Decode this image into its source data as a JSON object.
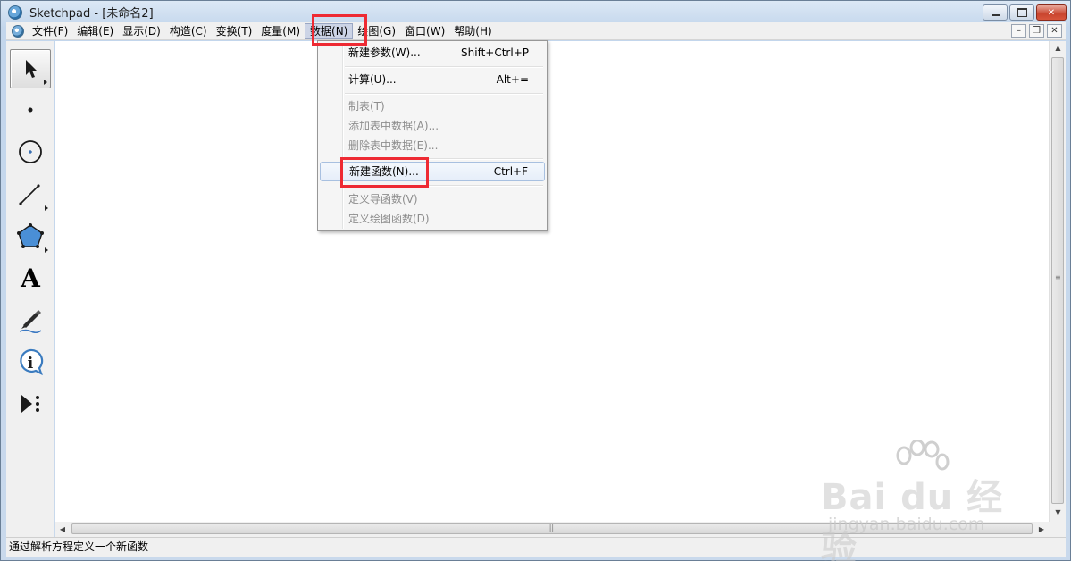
{
  "window": {
    "app_name": "Sketchpad",
    "document_title": " - [未命名2]"
  },
  "menubar": {
    "items": [
      {
        "label": "文件(F)"
      },
      {
        "label": "编辑(E)"
      },
      {
        "label": "显示(D)"
      },
      {
        "label": "构造(C)"
      },
      {
        "label": "变换(T)"
      },
      {
        "label": "度量(M)"
      },
      {
        "label": "数据(N)",
        "active": true
      },
      {
        "label": "绘图(G)"
      },
      {
        "label": "窗口(W)"
      },
      {
        "label": "帮助(H)"
      }
    ]
  },
  "toolbox": {
    "tools": [
      {
        "name": "arrow-select-tool",
        "selected": true
      },
      {
        "name": "point-tool"
      },
      {
        "name": "compass-tool"
      },
      {
        "name": "straightedge-tool"
      },
      {
        "name": "polygon-tool"
      },
      {
        "name": "text-tool",
        "glyph": "A"
      },
      {
        "name": "marker-tool"
      },
      {
        "name": "information-tool",
        "glyph": "i"
      },
      {
        "name": "custom-tool"
      }
    ]
  },
  "data_menu": {
    "items": [
      {
        "label": "新建参数(W)...",
        "shortcut": "Shift+Ctrl+P",
        "enabled": true
      },
      {
        "label": "计算(U)...",
        "shortcut": "Alt+=",
        "enabled": true
      },
      {
        "label": "制表(T)",
        "shortcut": "",
        "enabled": false
      },
      {
        "label": "添加表中数据(A)...",
        "shortcut": "",
        "enabled": false
      },
      {
        "label": "删除表中数据(E)...",
        "shortcut": "",
        "enabled": false
      },
      {
        "label": "新建函数(N)...",
        "shortcut": "Ctrl+F",
        "enabled": true,
        "hovered": true
      },
      {
        "label": "定义导函数(V)",
        "shortcut": "",
        "enabled": false
      },
      {
        "label": "定义绘图函数(D)",
        "shortcut": "",
        "enabled": false
      }
    ]
  },
  "statusbar": {
    "text": "通过解析方程定义一个新函数"
  },
  "watermark": {
    "logo": "Bai du 经验",
    "url": "jingyan.baidu.com"
  },
  "colors": {
    "highlight": "#ee2a33",
    "canvas": "#ffffff",
    "chrome": "#f0f0f0"
  }
}
